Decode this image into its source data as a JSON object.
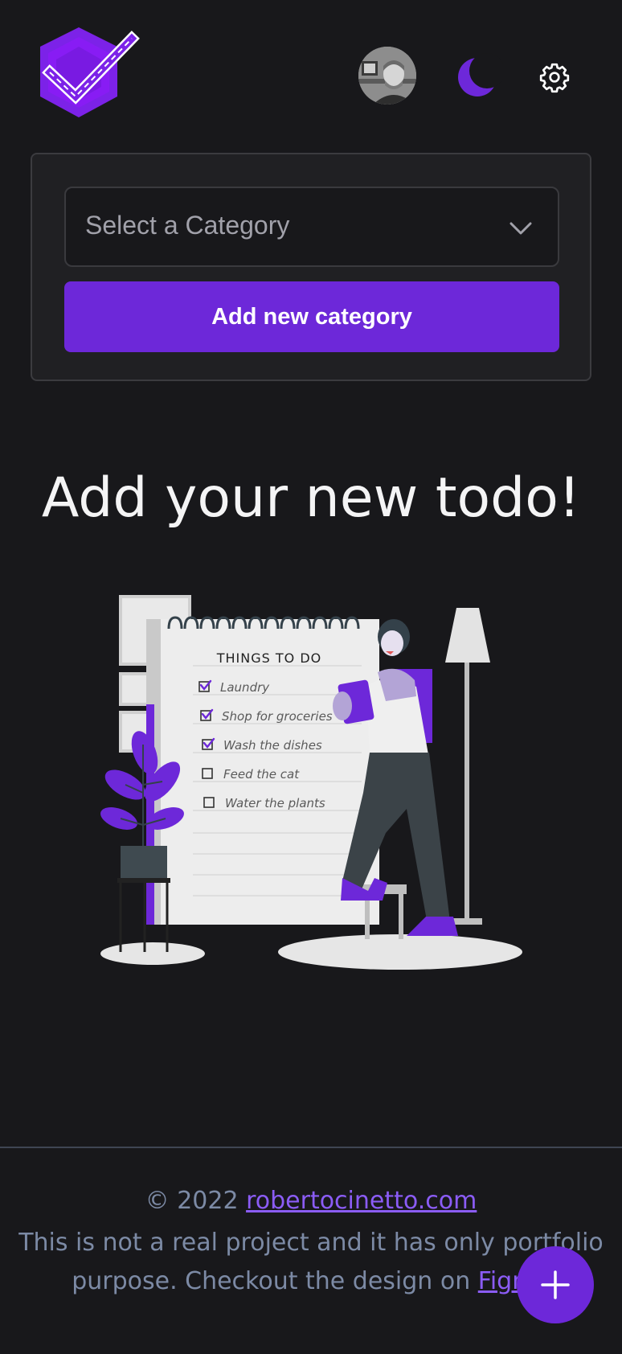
{
  "header": {
    "logo_icon": "checkmark-hexagon-logo",
    "avatar_alt": "user avatar",
    "theme_icon": "moon-icon",
    "settings_icon": "gear-icon"
  },
  "category_card": {
    "select_placeholder": "Select a Category",
    "add_button_label": "Add new category"
  },
  "main": {
    "title": "Add your new todo!"
  },
  "illustration": {
    "heading": "THINGS TO DO",
    "items": [
      {
        "label": "Laundry",
        "checked": true
      },
      {
        "label": "Shop for groceries",
        "checked": true
      },
      {
        "label": "Wash the dishes",
        "checked": true
      },
      {
        "label": "Feed the cat",
        "checked": false
      },
      {
        "label": "Water the plants",
        "checked": false
      }
    ]
  },
  "footer": {
    "copyright": "© 2022 ",
    "site_link": "robertocinetto.com",
    "note_text": "This is not a real project and it has only portfolio purpose. Checkout the design on ",
    "figma_link": "Figma"
  },
  "fab": {
    "icon": "plus-icon"
  },
  "colors": {
    "background": "#18181b",
    "accent": "#6d28d9",
    "link": "#8b5cf6",
    "muted_text": "#7c8aa5"
  }
}
